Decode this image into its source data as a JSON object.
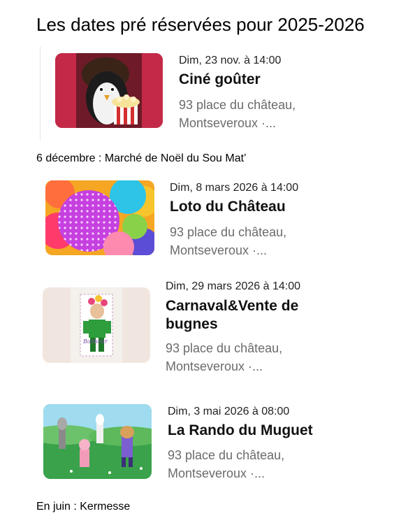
{
  "page": {
    "title": "Les dates pré réservées pour 2025-2026",
    "notes": [
      "6 décembre : Marché de Noël du Sou Mat’",
      "En juin : Kermesse"
    ]
  },
  "events": [
    {
      "date": "Dim, 23 nov. à 14:00",
      "title": "Ciné goûter",
      "address_line1": "93 place du château,",
      "address_line2": "Montseveroux ·...",
      "image": "penguin-popcorn-image"
    },
    {
      "date": "Dim, 8 mars 2026 à 14:00",
      "title": "Loto du Château",
      "address_line1": "93 place du château,",
      "address_line2": "Montseveroux ·...",
      "image": "colorful-balls-image"
    },
    {
      "date": "Dim, 29 mars 2026 à 14:00",
      "title_line1": "Carnaval&Vente de",
      "title_line2": "bugnes",
      "address_line1": "93 place du château,",
      "address_line2": "Montseveroux ·...",
      "image": "bonhomme-carnaval-image"
    },
    {
      "date": "Dim, 3 mai 2026 à 08:00",
      "title": "La Rando du Muguet",
      "address_line1": "93 place du château,",
      "address_line2": "Montseveroux ·...",
      "image": "animals-meadow-image"
    }
  ]
}
